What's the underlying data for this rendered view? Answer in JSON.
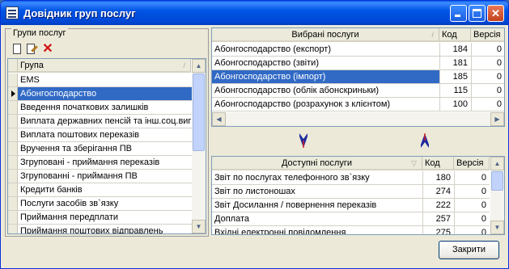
{
  "window": {
    "title": "Довідник груп послуг",
    "minimize_glyph": "_",
    "maximize_glyph": "□",
    "close_glyph": "✕"
  },
  "groups_panel": {
    "legend": "Групи послуг",
    "toolbar": {
      "new_icon": "new-document-icon",
      "edit_icon": "edit-document-icon",
      "delete_icon": "delete-x-icon",
      "delete_glyph": "✕"
    },
    "column_header": "Група",
    "rows": [
      "EMS",
      "Абонгосподарство",
      "Введення початкових залишків",
      "Виплата державних пенсій та інш.соц.виг",
      "Виплата поштових переказів",
      "Вручення та зберігання ПВ",
      "Згруповані - приймання переказів",
      "Згрупованні - приймання ПВ",
      "Кредити банків",
      "Послуги засобів зв`язку",
      "Приймання передплати",
      "Приймання поштових відправлень"
    ],
    "selected_index": 1
  },
  "selected_services": {
    "headers": {
      "name": "Вибрані послуги",
      "code": "Код",
      "version": "Версія"
    },
    "rows": [
      {
        "name": "Абонгосподарство (експорт)",
        "code": "184",
        "version": "0"
      },
      {
        "name": "Абонгосподарство (звіти)",
        "code": "181",
        "version": "0"
      },
      {
        "name": "Абонгосподарство (імпорт)",
        "code": "185",
        "version": "0"
      },
      {
        "name": "Абонгосподарство (облік абонскриньки)",
        "code": "115",
        "version": "0"
      },
      {
        "name": "Абонгосподарство (розрахунок з клієнтом)",
        "code": "100",
        "version": "0"
      }
    ],
    "selected_index": 2
  },
  "transfer": {
    "move_down_icon": "arrow-down-icon",
    "move_up_icon": "arrow-up-icon"
  },
  "available_services": {
    "headers": {
      "name": "Доступні послуги",
      "code": "Код",
      "version": "Версія"
    },
    "rows": [
      {
        "name": "Звіт по послугах телефонного зв`язку",
        "code": "180",
        "version": "0"
      },
      {
        "name": "Звіт по листоношах",
        "code": "274",
        "version": "0"
      },
      {
        "name": "Звіт Досилання / повернення переказів",
        "code": "222",
        "version": "0"
      },
      {
        "name": "Доплата",
        "code": "257",
        "version": "0"
      },
      {
        "name": "Вхідні електронні повідомлення",
        "code": "275",
        "version": "0"
      }
    ]
  },
  "footer": {
    "close_label": "Закрити"
  },
  "colors": {
    "titlebar": "#0055e5",
    "selection": "#316ac5",
    "arrow": "#1e2a9e",
    "window_bg": "#ece9d8"
  }
}
